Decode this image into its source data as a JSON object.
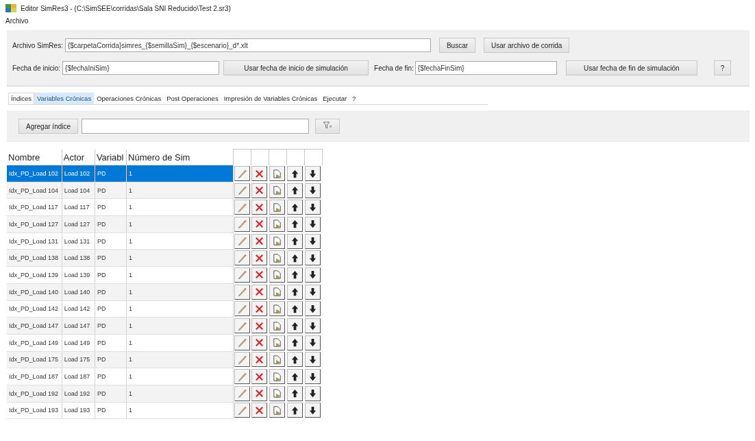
{
  "window": {
    "title": "Editor SimRes3 - (C:\\SimSEE\\corridas\\Sala SNI Reducido\\Test 2.sr3)"
  },
  "menu": [
    "Archivo"
  ],
  "params": {
    "file_label": "Archivo SimRes:",
    "file_value": "{$carpetaCorrida}simres_{$semillaSim}_{$escenario}_d*.xlt",
    "search_button": "Buscar",
    "use_file_button": "Usar archivo de corrida",
    "start_label": "Fecha de inicio:",
    "start_value": "{$fechaIniSim}",
    "use_start_button": "Usar fecha de inicio de simulación",
    "end_label": "Fecha de fin:",
    "end_value": "{$fechaFinSim}",
    "use_end_button": "Usar fecha de fin de simulación",
    "help_button": "?"
  },
  "tabs": [
    {
      "label": "Índices",
      "selected": true,
      "hover": false
    },
    {
      "label": "Variables Crónicas",
      "selected": false,
      "hover": true
    },
    {
      "label": "Operaciones Crónicas",
      "selected": false,
      "hover": false
    },
    {
      "label": "Post Operaciones",
      "selected": false,
      "hover": false
    },
    {
      "label": "Impresión de Variables Crónicas",
      "selected": false,
      "hover": false
    },
    {
      "label": "Ejecutar",
      "selected": false,
      "hover": false
    },
    {
      "label": "?",
      "selected": false,
      "hover": false
    }
  ],
  "toolbar": {
    "add_button": "Agregar índice"
  },
  "table": {
    "columns": [
      "Nombre",
      "Actor",
      "Variabl",
      "Número de Sim"
    ],
    "rows": [
      {
        "cells": [
          "Idx_PD_Load 102",
          "Load 102",
          "PD",
          "1"
        ],
        "selected": true
      },
      {
        "cells": [
          "Idx_PD_Load 104",
          "Load 104",
          "PD",
          "1"
        ],
        "selected": false
      },
      {
        "cells": [
          "Idx_PD_Load 117",
          "Load 117",
          "PD",
          "1"
        ],
        "selected": false
      },
      {
        "cells": [
          "Idx_PD_Load 127",
          "Load 127",
          "PD",
          "1"
        ],
        "selected": false
      },
      {
        "cells": [
          "Idx_PD_Load 131",
          "Load 131",
          "PD",
          "1"
        ],
        "selected": false
      },
      {
        "cells": [
          "Idx_PD_Load 138",
          "Load 138",
          "PD",
          "1"
        ],
        "selected": false
      },
      {
        "cells": [
          "Idx_PD_Load 139",
          "Load 139",
          "PD",
          "1"
        ],
        "selected": false
      },
      {
        "cells": [
          "Idx_PD_Load 140",
          "Load 140",
          "PD",
          "1"
        ],
        "selected": false
      },
      {
        "cells": [
          "Idx_PD_Load 142",
          "Load 142",
          "PD",
          "1"
        ],
        "selected": false
      },
      {
        "cells": [
          "Idx_PD_Load 147",
          "Load 147",
          "PD",
          "1"
        ],
        "selected": false
      },
      {
        "cells": [
          "Idx_PD_Load 149",
          "Load 149",
          "PD",
          "1"
        ],
        "selected": false
      },
      {
        "cells": [
          "Idx_PD_Load 175",
          "Load 175",
          "PD",
          "1"
        ],
        "selected": false
      },
      {
        "cells": [
          "Idx_PD_Load 187",
          "Load 187",
          "PD",
          "1"
        ],
        "selected": false
      },
      {
        "cells": [
          "Idx_PD_Load 192",
          "Load 192",
          "PD",
          "1"
        ],
        "selected": false
      },
      {
        "cells": [
          "Idx_PD_Load 193",
          "Load 193",
          "PD",
          "1"
        ],
        "selected": false
      }
    ]
  }
}
